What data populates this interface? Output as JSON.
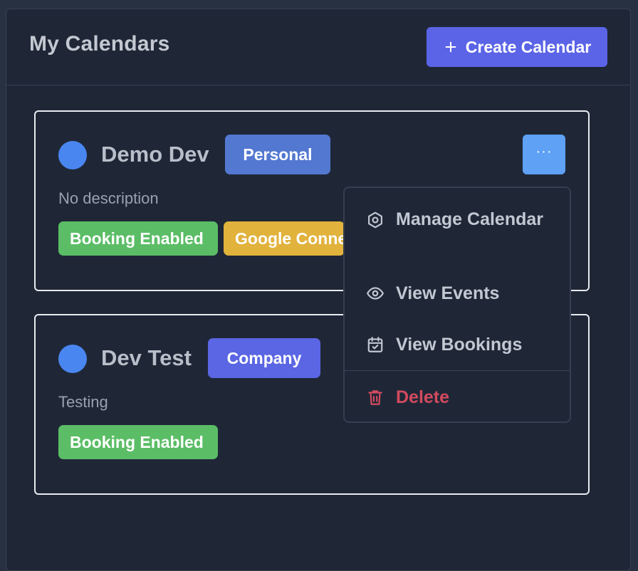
{
  "header": {
    "title": "My Calendars",
    "create_button_label": "Create Calendar"
  },
  "calendars": [
    {
      "name": "Demo Dev",
      "type": "Personal",
      "description": "No description",
      "color": "#4a86f0",
      "tags": [
        "Booking Enabled",
        "Google Connected"
      ]
    },
    {
      "name": "Dev Test",
      "type": "Company",
      "description": "Testing",
      "color": "#4a86f0",
      "tags": [
        "Booking Enabled"
      ]
    }
  ],
  "more_button_label": "···",
  "menu": {
    "items": [
      {
        "label": "Manage Calendar",
        "icon": "settings-hexagon-icon"
      },
      {
        "label": "View Events",
        "icon": "eye-icon"
      },
      {
        "label": "View Bookings",
        "icon": "calendar-check-icon"
      },
      {
        "label": "Delete",
        "icon": "trash-icon"
      }
    ]
  },
  "colors": {
    "accent": "#5b64e6",
    "booking_tag": "#5bbd66",
    "google_tag": "#e1b23c",
    "danger": "#d34a5e"
  }
}
